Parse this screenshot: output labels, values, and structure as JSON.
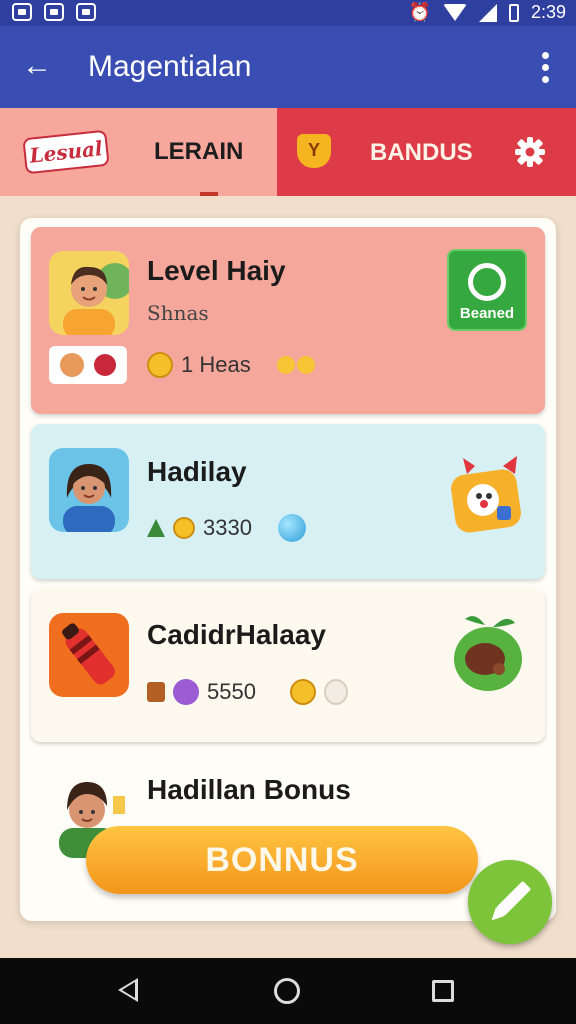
{
  "status_bar": {
    "time": "2:39"
  },
  "app_bar": {
    "title": "Magentialan"
  },
  "tabs": {
    "logo_text": "Lesual",
    "learn_label": "LERAIN",
    "shield_glyph": "Y",
    "bonus_label": "BANDUS"
  },
  "rows": [
    {
      "title": "Level Haiy",
      "subtitle": "Shnas",
      "meta_text": "1 Heas",
      "action_label": "Beaned"
    },
    {
      "title": "Hadilay",
      "meta_text": "3330",
      "meta_prefix": "A"
    },
    {
      "title": "CadidrHalaay",
      "meta_text": "5550",
      "meta_prefix": "Å"
    },
    {
      "title": "Hadillan Bonus"
    }
  ],
  "bonus_button": {
    "label": "BONNUS"
  },
  "colors": {
    "primary": "#3a4db2",
    "tab_active": "#f7a79c",
    "tab_red": "#dd3b47",
    "accent_orange": "#f4951a",
    "fab_green": "#7dc43b"
  }
}
